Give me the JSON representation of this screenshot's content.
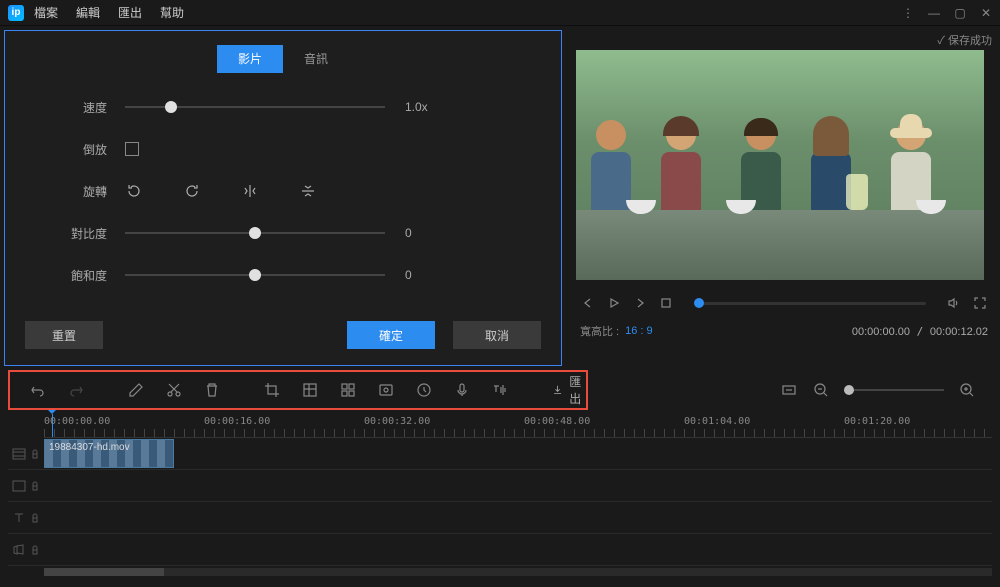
{
  "menu": {
    "file": "檔案",
    "edit": "編輯",
    "export": "匯出",
    "help": "幫助"
  },
  "save_status": "✓ 保存成功",
  "edit_panel": {
    "tab_video": "影片",
    "tab_audio": "音訊",
    "speed_label": "速度",
    "speed_value": "1.0x",
    "reverse_label": "倒放",
    "rotate_label": "旋轉",
    "contrast_label": "對比度",
    "contrast_value": "0",
    "saturation_label": "飽和度",
    "saturation_value": "0",
    "btn_reset": "重置",
    "btn_ok": "確定",
    "btn_cancel": "取消"
  },
  "preview": {
    "ratio_label": "寬高比 :",
    "ratio_value": "16 : 9",
    "time_current": "00:00:00.00",
    "time_total": "00:00:12.02"
  },
  "toolbar": {
    "export_label": "匯出"
  },
  "timeline": {
    "ticks": [
      "00:00:00.00",
      "00:00:16.00",
      "00:00:32.00",
      "00:00:48.00",
      "00:01:04.00",
      "00:01:20.00"
    ],
    "clip_name": "19884307-hd.mov"
  }
}
